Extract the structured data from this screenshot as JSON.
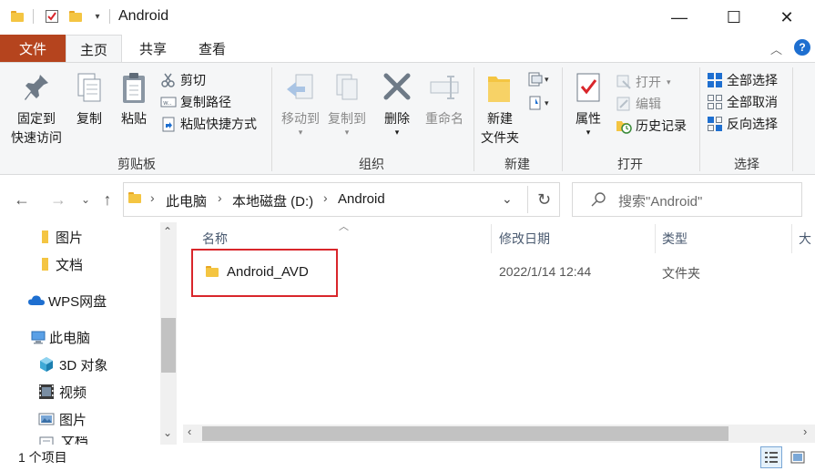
{
  "window": {
    "title": "Android",
    "controls": {
      "minimize": "—",
      "maximize": "☐",
      "close": "✕"
    }
  },
  "ribbon": {
    "tabs": [
      "文件",
      "主页",
      "共享",
      "查看"
    ],
    "clipboard": {
      "pin_label_1": "固定到",
      "pin_label_2": "快速访问",
      "copy": "复制",
      "paste": "粘贴",
      "cut": "剪切",
      "copy_path": "复制路径",
      "paste_shortcut": "粘贴快捷方式",
      "group_label": "剪贴板"
    },
    "organize": {
      "move_to": "移动到",
      "copy_to": "复制到",
      "delete": "删除",
      "rename": "重命名",
      "group_label": "组织"
    },
    "new": {
      "new_folder_1": "新建",
      "new_folder_2": "文件夹",
      "group_label": "新建"
    },
    "open": {
      "properties": "属性",
      "open": "打开",
      "edit": "编辑",
      "history": "历史记录",
      "group_label": "打开"
    },
    "select": {
      "select_all": "全部选择",
      "select_none": "全部取消",
      "invert": "反向选择",
      "group_label": "选择"
    }
  },
  "address": {
    "crumbs": [
      "此电脑",
      "本地磁盘 (D:)",
      "Android"
    ],
    "search_placeholder": "搜索\"Android\""
  },
  "nav_pane": {
    "items": [
      "图片",
      "文档",
      "WPS网盘",
      "此电脑",
      "3D 对象",
      "视频",
      "图片",
      "文档"
    ]
  },
  "file_list": {
    "columns": [
      "名称",
      "修改日期",
      "类型",
      "大"
    ],
    "rows": [
      {
        "name": "Android_AVD",
        "modified": "2022/1/14 12:44",
        "type": "文件夹"
      }
    ]
  },
  "status": {
    "text": "1 个项目"
  },
  "colors": {
    "file_tab": "#b5441e",
    "highlight_box": "#d9262b",
    "folder": "#f4c542"
  }
}
